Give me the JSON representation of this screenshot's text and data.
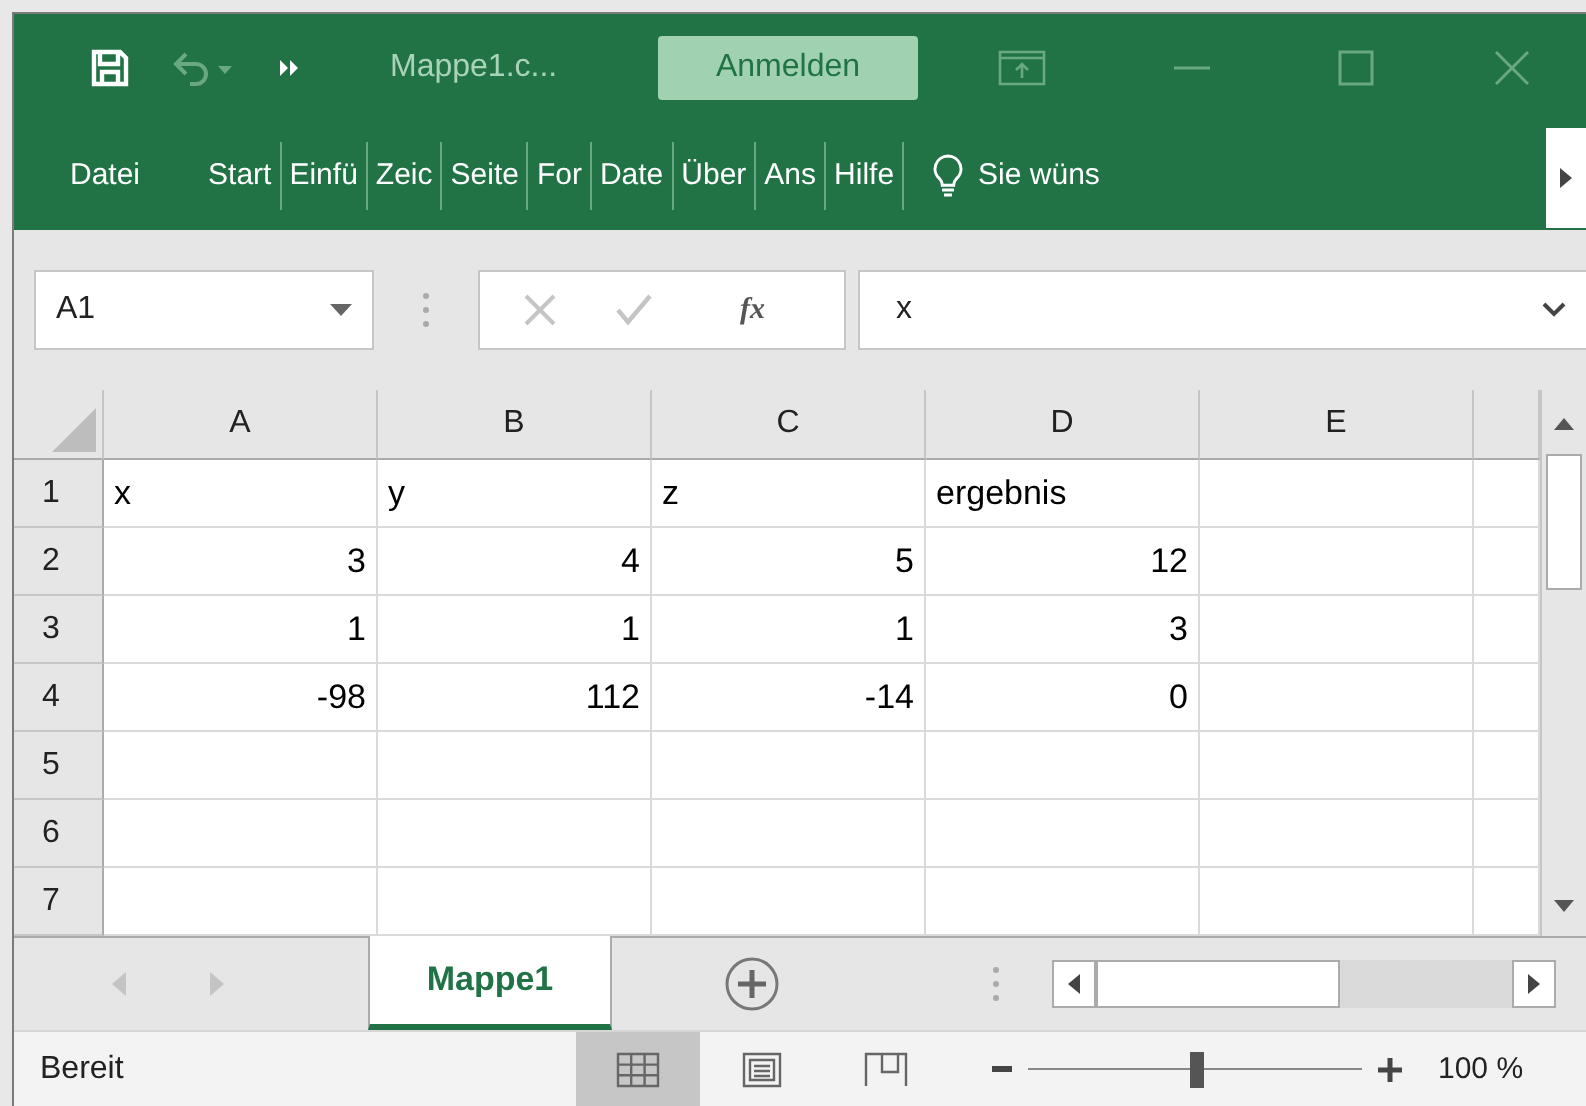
{
  "title_bar": {
    "title": "Mappe1.c...",
    "sign_in": "Anmelden"
  },
  "ribbon": {
    "tabs": [
      {
        "label": "Datei"
      },
      {
        "label": "Start"
      },
      {
        "label": "Einfü"
      },
      {
        "label": "Zeic"
      },
      {
        "label": "Seite"
      },
      {
        "label": "For"
      },
      {
        "label": "Date"
      },
      {
        "label": "Über"
      },
      {
        "label": "Ans"
      },
      {
        "label": "Hilfe"
      }
    ],
    "tell_me": "Sie wüns"
  },
  "formula_bar": {
    "name_box": "A1",
    "function_symbol": "fx",
    "formula": "x"
  },
  "sheet": {
    "columns": [
      "A",
      "B",
      "C",
      "D",
      "E"
    ],
    "rows": [
      {
        "number": "1",
        "cells": [
          {
            "text": "x",
            "kind": "text"
          },
          {
            "text": "y",
            "kind": "text"
          },
          {
            "text": "z",
            "kind": "text"
          },
          {
            "text": "ergebnis",
            "kind": "text"
          }
        ]
      },
      {
        "number": "2",
        "cells": [
          {
            "text": "3",
            "kind": "number"
          },
          {
            "text": "4",
            "kind": "number"
          },
          {
            "text": "5",
            "kind": "number"
          },
          {
            "text": "12",
            "kind": "number"
          }
        ]
      },
      {
        "number": "3",
        "cells": [
          {
            "text": "1",
            "kind": "number"
          },
          {
            "text": "1",
            "kind": "number"
          },
          {
            "text": "1",
            "kind": "number"
          },
          {
            "text": "3",
            "kind": "number"
          }
        ]
      },
      {
        "number": "4",
        "cells": [
          {
            "text": "-98",
            "kind": "number"
          },
          {
            "text": "112",
            "kind": "number"
          },
          {
            "text": "-14",
            "kind": "number"
          },
          {
            "text": "0",
            "kind": "number"
          }
        ]
      },
      {
        "number": "5",
        "cells": []
      },
      {
        "number": "6",
        "cells": []
      },
      {
        "number": "7",
        "cells": []
      }
    ]
  },
  "sheet_tabs": [
    {
      "label": "Mappe1",
      "selected": true
    }
  ],
  "status_bar": {
    "status": "Bereit",
    "views": [
      {
        "kind": "normal",
        "selected": true
      },
      {
        "kind": "page_layout",
        "selected": false
      },
      {
        "kind": "page_break",
        "selected": false
      }
    ],
    "zoom": {
      "level": 0.5,
      "reading": "100 %"
    }
  }
}
